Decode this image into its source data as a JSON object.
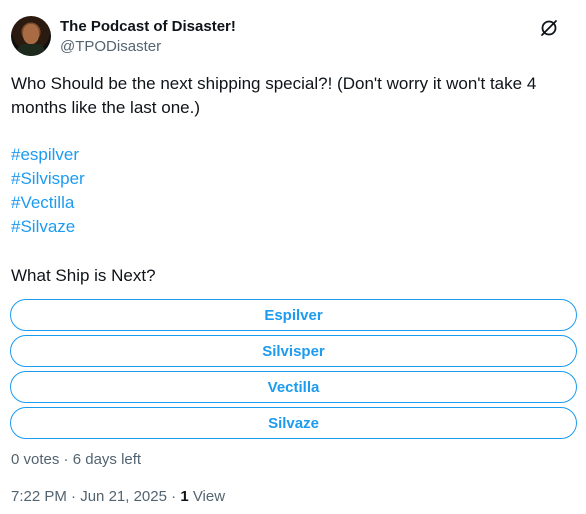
{
  "author": {
    "name": "The Podcast of Disaster!",
    "handle": "@TPODisaster"
  },
  "header_icon": "grok-slash-circle-icon",
  "tweet": {
    "text": "Who Should be the next shipping special?! (Don't worry it won't take 4 months like the last one.)",
    "hashtags": [
      "#espilver",
      "#Silvisper",
      "#Vectilla",
      "#Silvaze"
    ]
  },
  "poll": {
    "question": "What Ship is Next?",
    "options": [
      "Espilver",
      "Silvisper",
      "Vectilla",
      "Silvaze"
    ],
    "votes_label": "0 votes",
    "separator": "·",
    "time_left": "6 days left"
  },
  "footer": {
    "time": "7:22 PM",
    "separator": "·",
    "date": "Jun 21, 2025",
    "views_count": "1",
    "views_label": "View"
  },
  "colors": {
    "accent": "#1d9bf0",
    "text": "#0f1419",
    "secondary": "#536471"
  }
}
